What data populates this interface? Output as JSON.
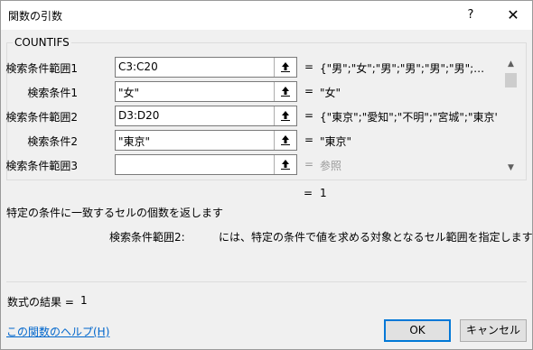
{
  "window": {
    "title": "関数の引数",
    "help_label": "?",
    "close_label": "✕"
  },
  "function": {
    "name": "COUNTIFS",
    "description": "特定の条件に一致するセルの個数を返します",
    "result_equals": "=",
    "result_value": "1"
  },
  "arguments": [
    {
      "label": "検索条件範囲1",
      "value": "C3:C20",
      "equals": "=",
      "result": "{\"男\";\"女\";\"男\";\"男\";\"男\";\"男\";…",
      "result_gray": false
    },
    {
      "label": "検索条件1",
      "value": "\"女\"",
      "equals": "=",
      "result": "\"女\"",
      "result_gray": false
    },
    {
      "label": "検索条件範囲2",
      "value": "D3:D20",
      "equals": "=",
      "result": "{\"東京\";\"愛知\";\"不明\";\"宮城\";\"東京\"",
      "result_gray": false
    },
    {
      "label": "検索条件2",
      "value": "\"東京\"",
      "equals": "=",
      "result": "\"東京\"",
      "result_gray": false
    },
    {
      "label": "検索条件範囲3",
      "value": "",
      "equals": "=",
      "result": "参照",
      "result_gray": true
    }
  ],
  "argument_help": {
    "label": "検索条件範囲2:",
    "text": "には、特定の条件で値を求める対象となるセル範囲を指定します"
  },
  "formula_result": {
    "label": "数式の結果 =",
    "value": "1"
  },
  "footer": {
    "help_link": "この関数のヘルプ(H)",
    "ok_label": "OK",
    "cancel_label": "キャンセル"
  },
  "colors": {
    "accent": "#0078d7",
    "link": "#0066cc",
    "dialog_bg": "#f0f0f0"
  },
  "icons": {
    "ref_button": "collapse-dialog-icon",
    "scroll_up": "chevron-up-icon",
    "scroll_down": "chevron-down-icon"
  }
}
